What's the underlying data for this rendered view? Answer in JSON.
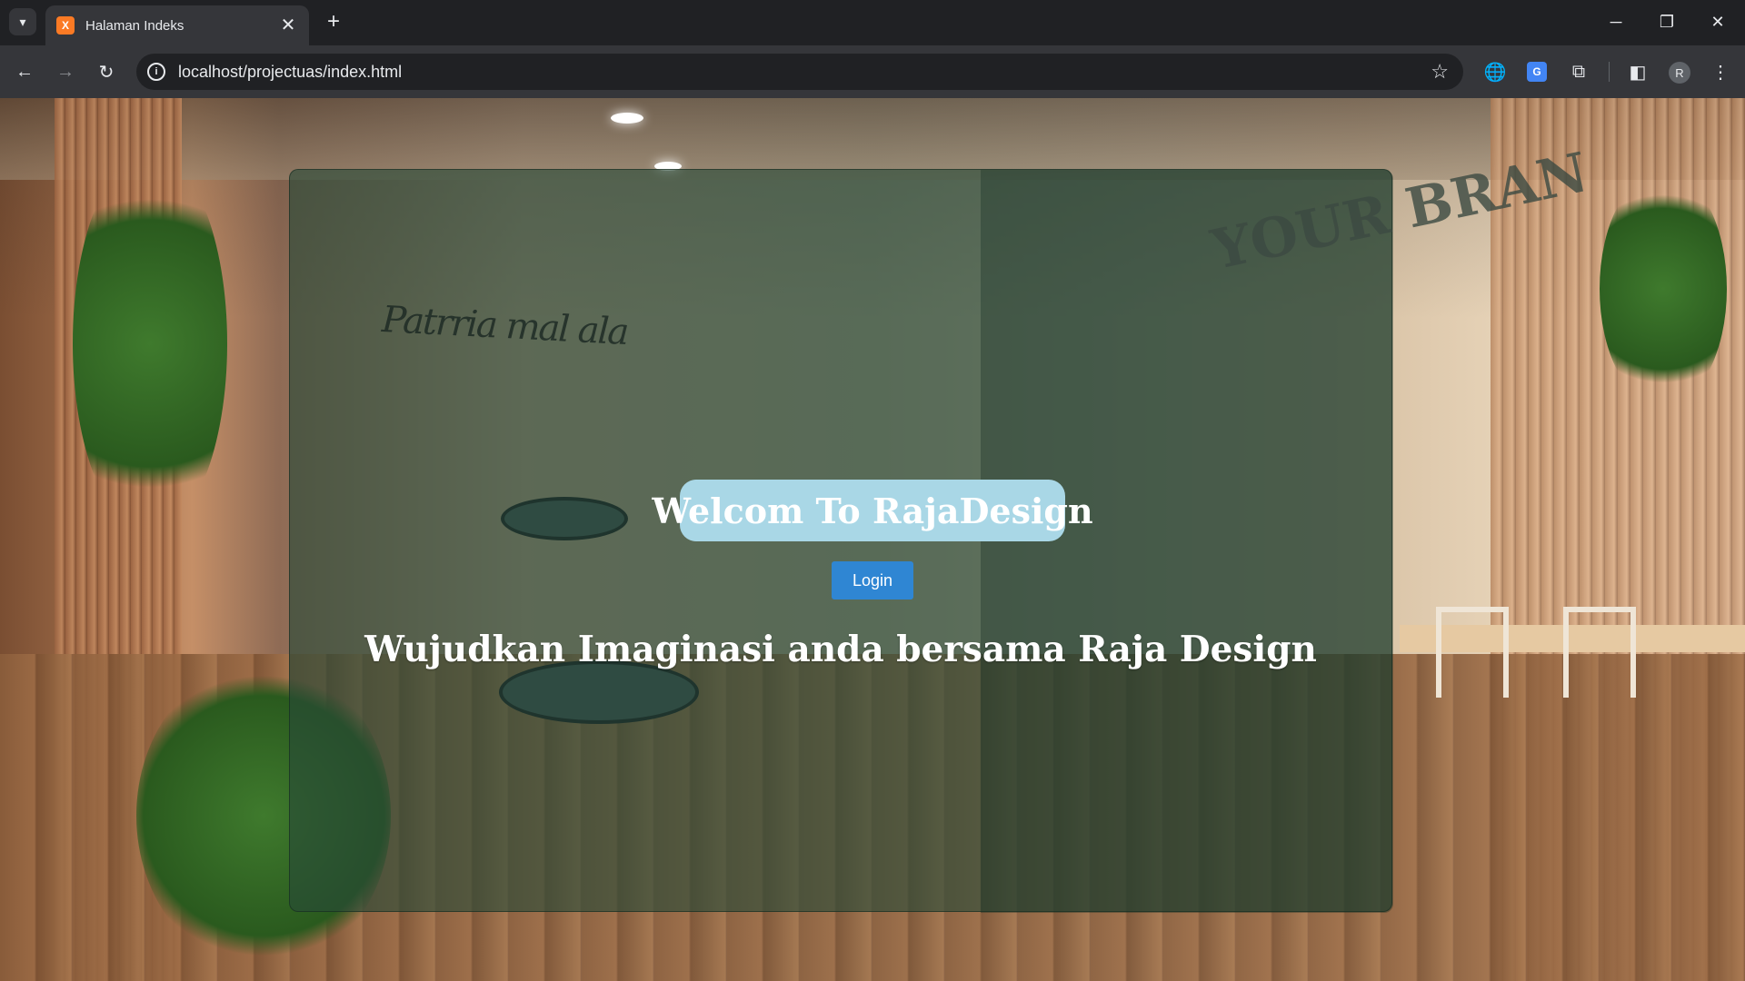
{
  "browser": {
    "tab": {
      "title": "Halaman Indeks",
      "favicon": "xampp-icon"
    },
    "address": {
      "url": "localhost/projectuas/index.html"
    },
    "profile_initial": "R",
    "icons": {
      "tab_search": "▾",
      "tab_close": "✕",
      "new_tab": "+",
      "minimize": "─",
      "restore": "❐",
      "close": "✕",
      "back": "←",
      "forward": "→",
      "reload": "↻",
      "info": "i",
      "star": "☆",
      "globe": "🌐",
      "translate": "G",
      "extensions": "⧉",
      "sidepanel": "◧",
      "menu": "⋮"
    }
  },
  "page": {
    "heading": "Welcom To RajaDesign",
    "login_label": "Login",
    "tagline": "Wujudkan Imaginasi anda bersama Raja Design",
    "colors": {
      "heading_bg": "#a9d7e6",
      "button_bg": "#2f86d3",
      "overlay": "rgba(38,72,55,0.62)"
    }
  }
}
